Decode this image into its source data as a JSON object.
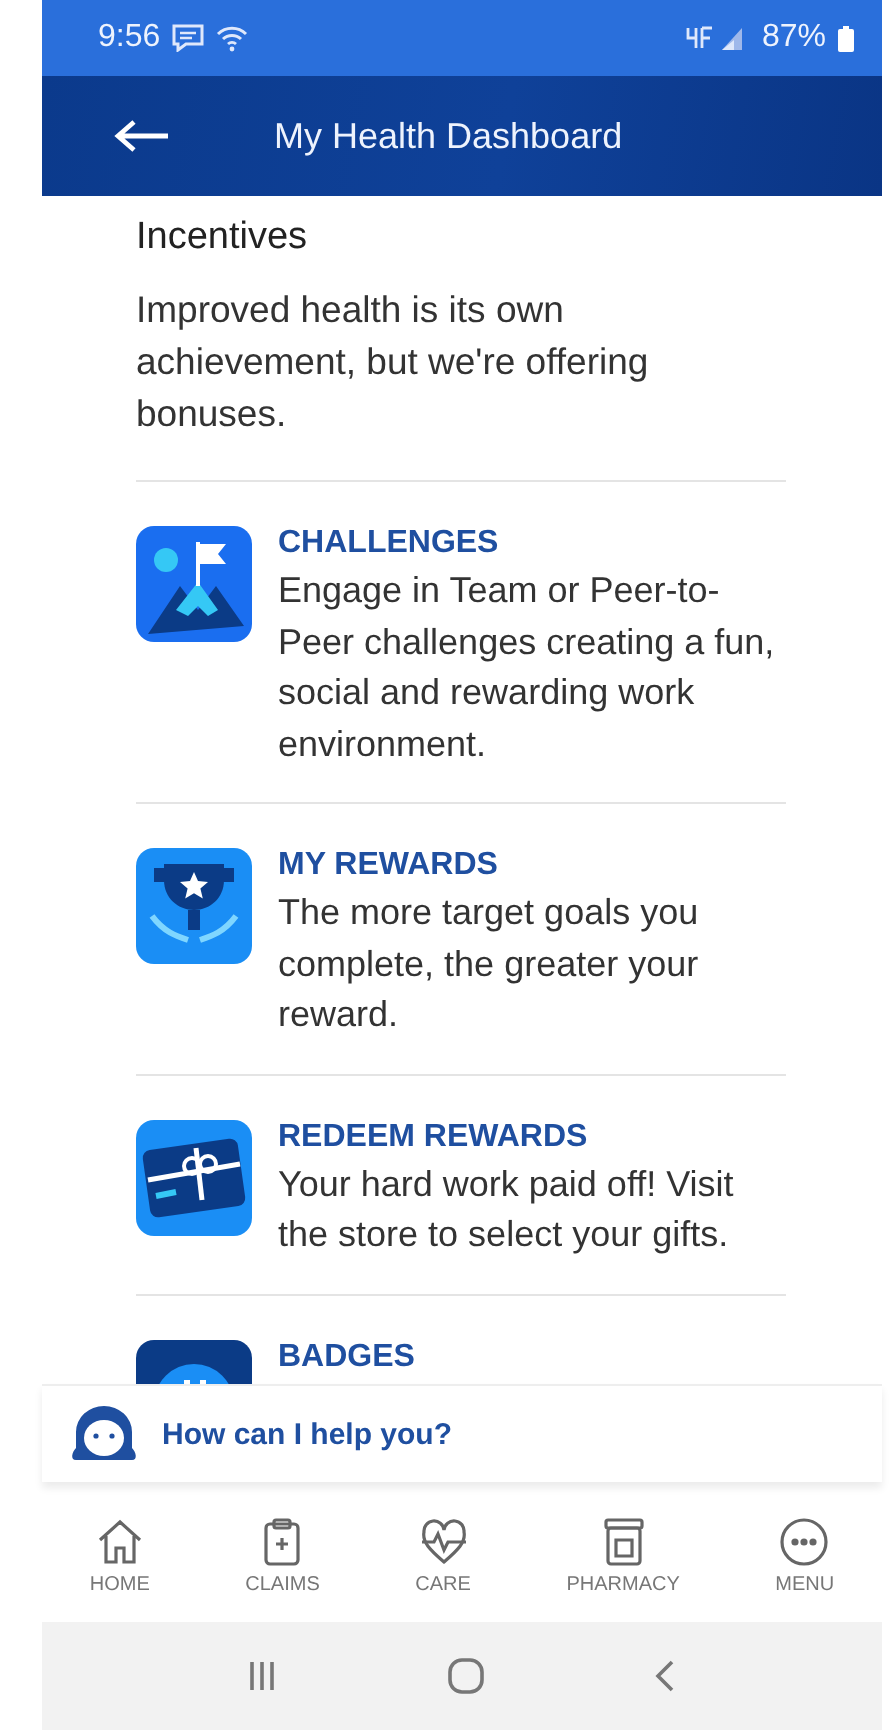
{
  "status_bar": {
    "time": "9:56",
    "battery": "87%"
  },
  "header": {
    "title": "My Health Dashboard"
  },
  "section": {
    "title": "Incentives",
    "intro": "Improved health is its own achievement, but we're offering bonuses."
  },
  "items": [
    {
      "title": "CHALLENGES",
      "description": "Engage in Team or Peer-to-Peer challenges creating a fun, social and rewarding work environment."
    },
    {
      "title": "MY REWARDS",
      "description": "The more target goals you complete, the greater your reward."
    },
    {
      "title": "REDEEM REWARDS",
      "description": "Your hard work paid off! Visit the store to select your gifts."
    },
    {
      "title": "BADGES"
    }
  ],
  "assistant": {
    "prompt": "How can I help you?"
  },
  "nav": [
    {
      "label": "HOME"
    },
    {
      "label": "CLAIMS"
    },
    {
      "label": "CARE"
    },
    {
      "label": "PHARMACY"
    },
    {
      "label": "MENU"
    }
  ]
}
